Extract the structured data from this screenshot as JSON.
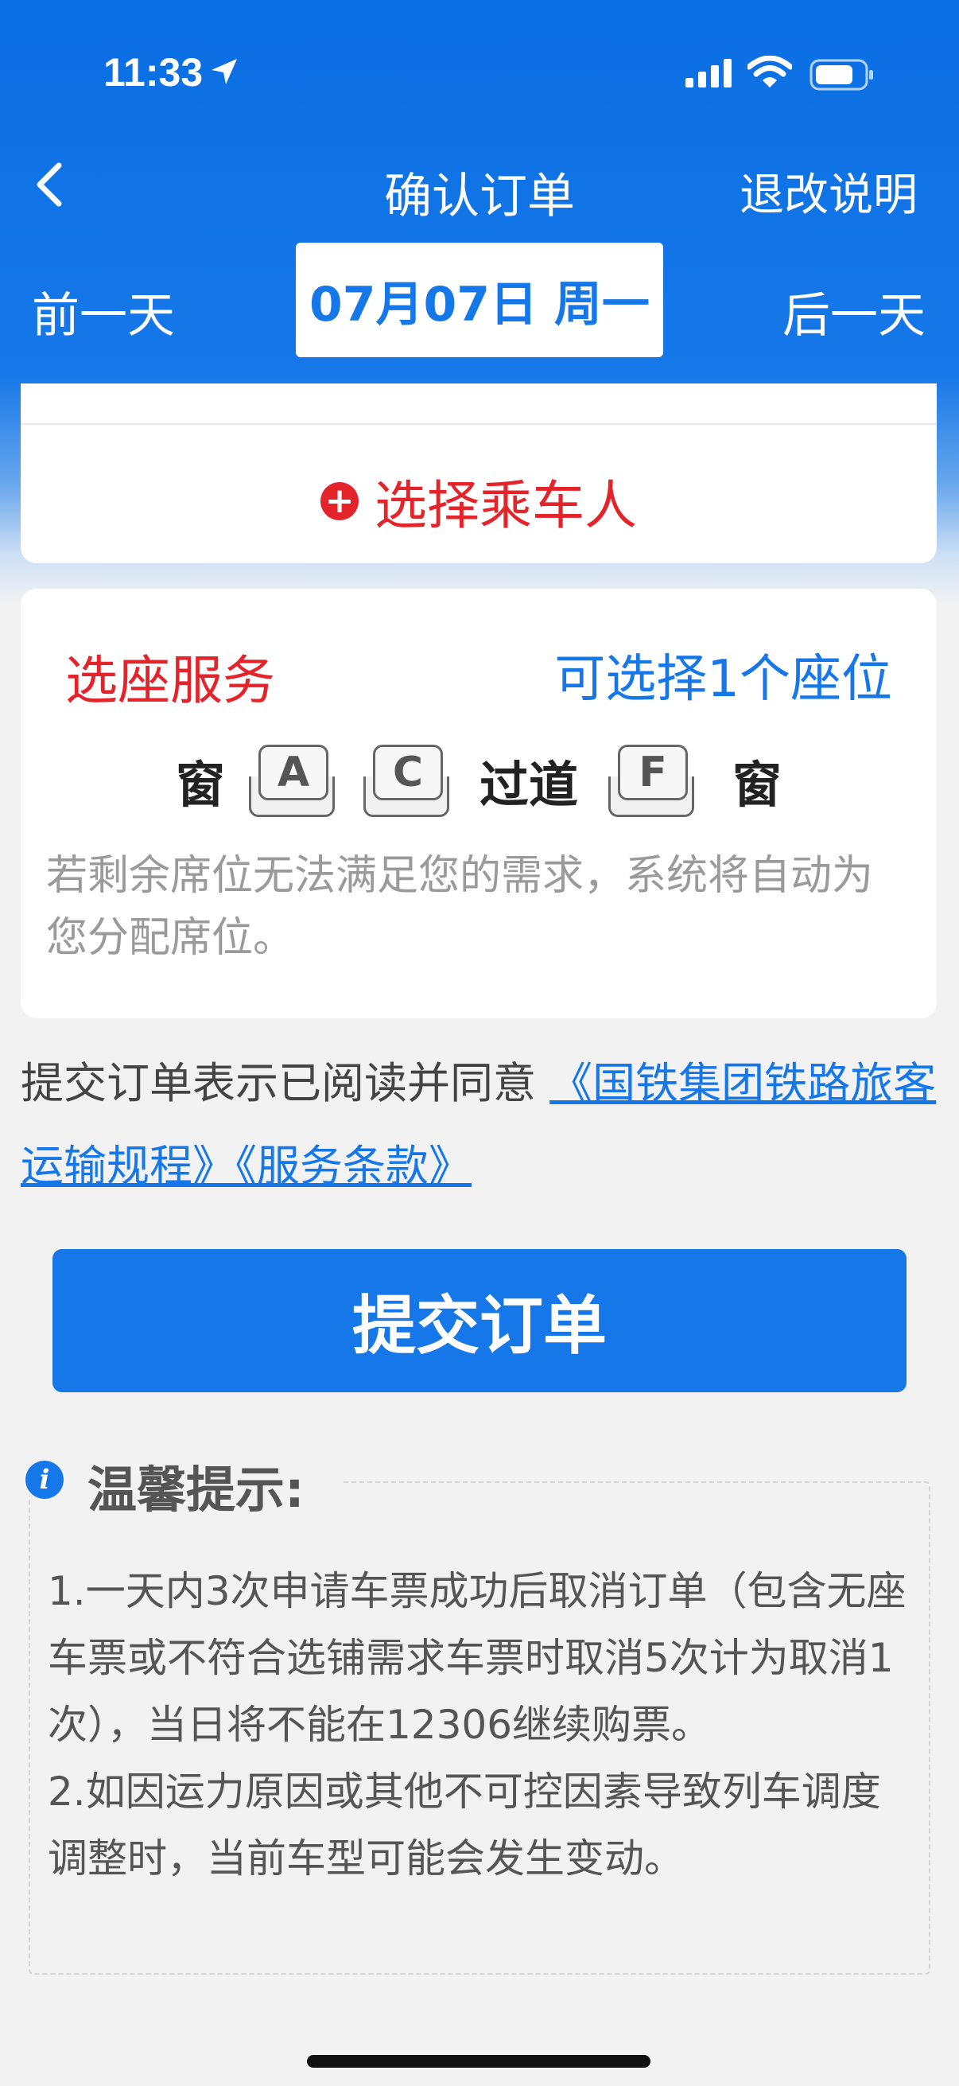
{
  "status_bar": {
    "time": "11:33"
  },
  "nav": {
    "title": "确认订单",
    "right_action": "退改说明"
  },
  "date_bar": {
    "prev": "前一天",
    "current": "07月07日 周一",
    "next": "后一天"
  },
  "passenger": {
    "add_label": "选择乘车人"
  },
  "seat_service": {
    "title": "选座服务",
    "quota": "可选择1个座位",
    "window_left": "窗",
    "aisle": "过道",
    "window_right": "窗",
    "seats": [
      "A",
      "C",
      "F"
    ],
    "note": "若剩余席位无法满足您的需求，系统将自动为您分配席位。"
  },
  "agreement": {
    "prefix": "提交订单表示已阅读并同意 ",
    "link": "《国铁集团铁路旅客运输规程》《服务条款》"
  },
  "submit": {
    "label": "提交订单"
  },
  "tips": {
    "title": "温馨提示:",
    "items": [
      "1.一天内3次申请车票成功后取消订单（包含无座车票或不符合选铺需求车票时取消5次计为取消1次），当日将不能在12306继续购票。",
      "2.如因运力原因或其他不可控因素导致列车调度调整时，当前车型可能会发生变动。"
    ]
  },
  "colors": {
    "primary": "#1677e8",
    "accent_red": "#e3242b",
    "background": "#f2f2f2"
  }
}
